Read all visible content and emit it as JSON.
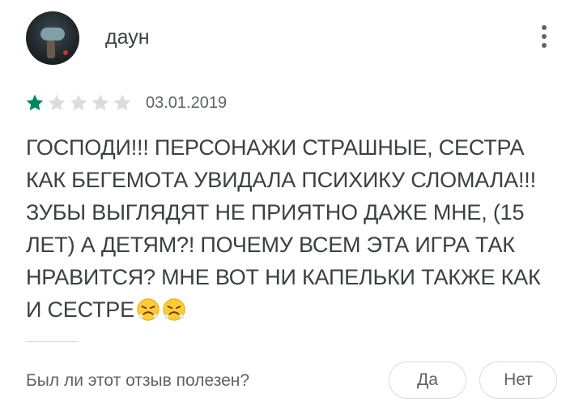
{
  "review": {
    "author": "даун",
    "rating": 1,
    "max_rating": 5,
    "date": "03.01.2019",
    "text": "ГОСПОДИ!!! ПЕРСОНАЖИ СТРАШНЫЕ, СЕСТРА КАК БЕГЕМОТА УВИДАЛА ПСИХИКУ СЛОМАЛА!!! ЗУБЫ ВЫГЛЯДЯТ НЕ ПРИЯТНО ДАЖЕ МНЕ, (15 ЛЕТ) А ДЕТЯМ?! ПОЧЕМУ ВСЕМ ЭТА ИГРА ТАК НРАВИТСЯ? МНЕ ВОТ НИ КАПЕЛЬКИ ТАКЖЕ КАК И СЕСТРЕ",
    "emojis": [
      "angry-face-emoji",
      "angry-face-emoji"
    ]
  },
  "feedback": {
    "question": "Был ли этот отзыв полезен?",
    "yes_label": "Да",
    "no_label": "Нет"
  },
  "icons": {
    "more": "more-vert-icon",
    "star": "star-icon"
  },
  "colors": {
    "star_filled": "#01875f",
    "star_empty": "#dadce0"
  }
}
